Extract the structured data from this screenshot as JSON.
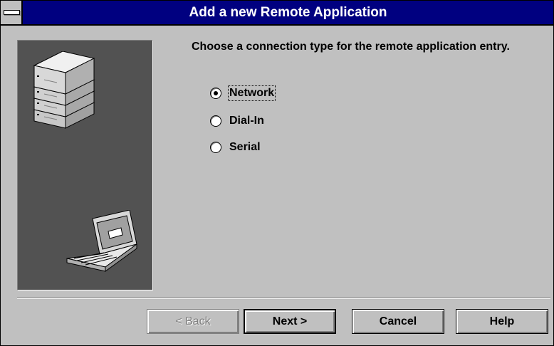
{
  "window": {
    "title": "Add a new Remote Application"
  },
  "prompt": "Choose a connection type for the remote application entry.",
  "options": [
    {
      "label": "Network",
      "selected": true
    },
    {
      "label": "Dial-In",
      "selected": false
    },
    {
      "label": "Serial",
      "selected": false
    }
  ],
  "buttons": {
    "back": "< Back",
    "next": "Next >",
    "cancel": "Cancel",
    "help": "Help"
  },
  "colors": {
    "titlebar": "#000080",
    "panel": "#525252",
    "face": "#c0c0c0"
  }
}
